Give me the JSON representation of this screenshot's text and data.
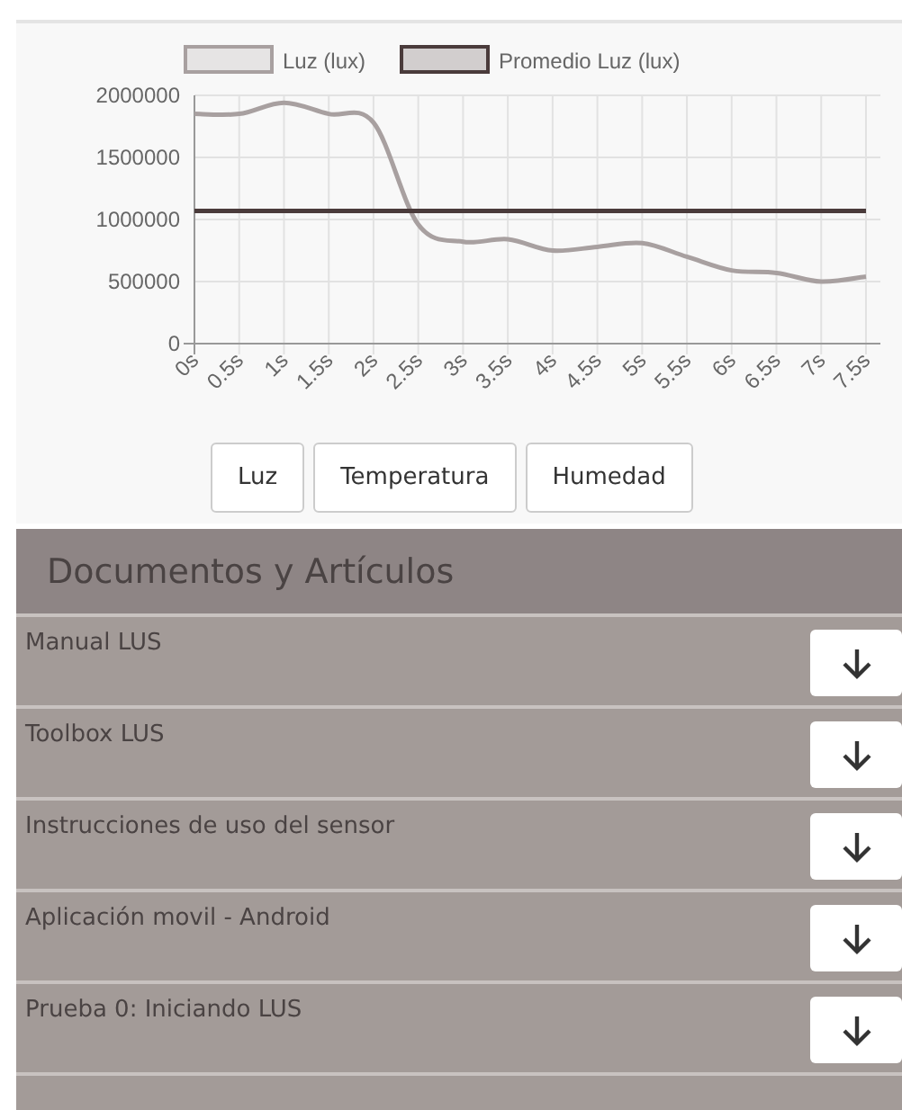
{
  "chart": {
    "chart_data": {
      "type": "line",
      "x": [
        "0s",
        "0.5s",
        "1s",
        "1.5s",
        "2s",
        "2.5s",
        "3s",
        "3.5s",
        "4s",
        "4.5s",
        "5s",
        "5.5s",
        "6s",
        "6.5s",
        "7s",
        "7.5s"
      ],
      "series": [
        {
          "name": "Luz (lux)",
          "color": "#a8a0a0",
          "values": [
            1850000,
            1850000,
            1940000,
            1850000,
            1780000,
            960000,
            820000,
            840000,
            750000,
            780000,
            810000,
            700000,
            590000,
            570000,
            500000,
            540000
          ]
        },
        {
          "name": "Promedio Luz (lux)",
          "color": "#4a3b3b",
          "values": [
            1070000,
            1070000,
            1070000,
            1070000,
            1070000,
            1070000,
            1070000,
            1070000,
            1070000,
            1070000,
            1070000,
            1070000,
            1070000,
            1070000,
            1070000,
            1070000
          ]
        }
      ],
      "ylim": [
        0,
        2000000
      ],
      "yticks": [
        0,
        500000,
        1000000,
        1500000,
        2000000
      ],
      "grid": true,
      "legend": true
    }
  },
  "sensor_buttons": [
    "Luz",
    "Temperatura",
    "Humedad"
  ],
  "documents": {
    "title": "Documentos y Artículos",
    "items": [
      "Manual LUS",
      "Toolbox LUS",
      "Instrucciones de uso del sensor",
      "Aplicación movil - Android",
      "Prueba 0: Iniciando LUS"
    ]
  }
}
